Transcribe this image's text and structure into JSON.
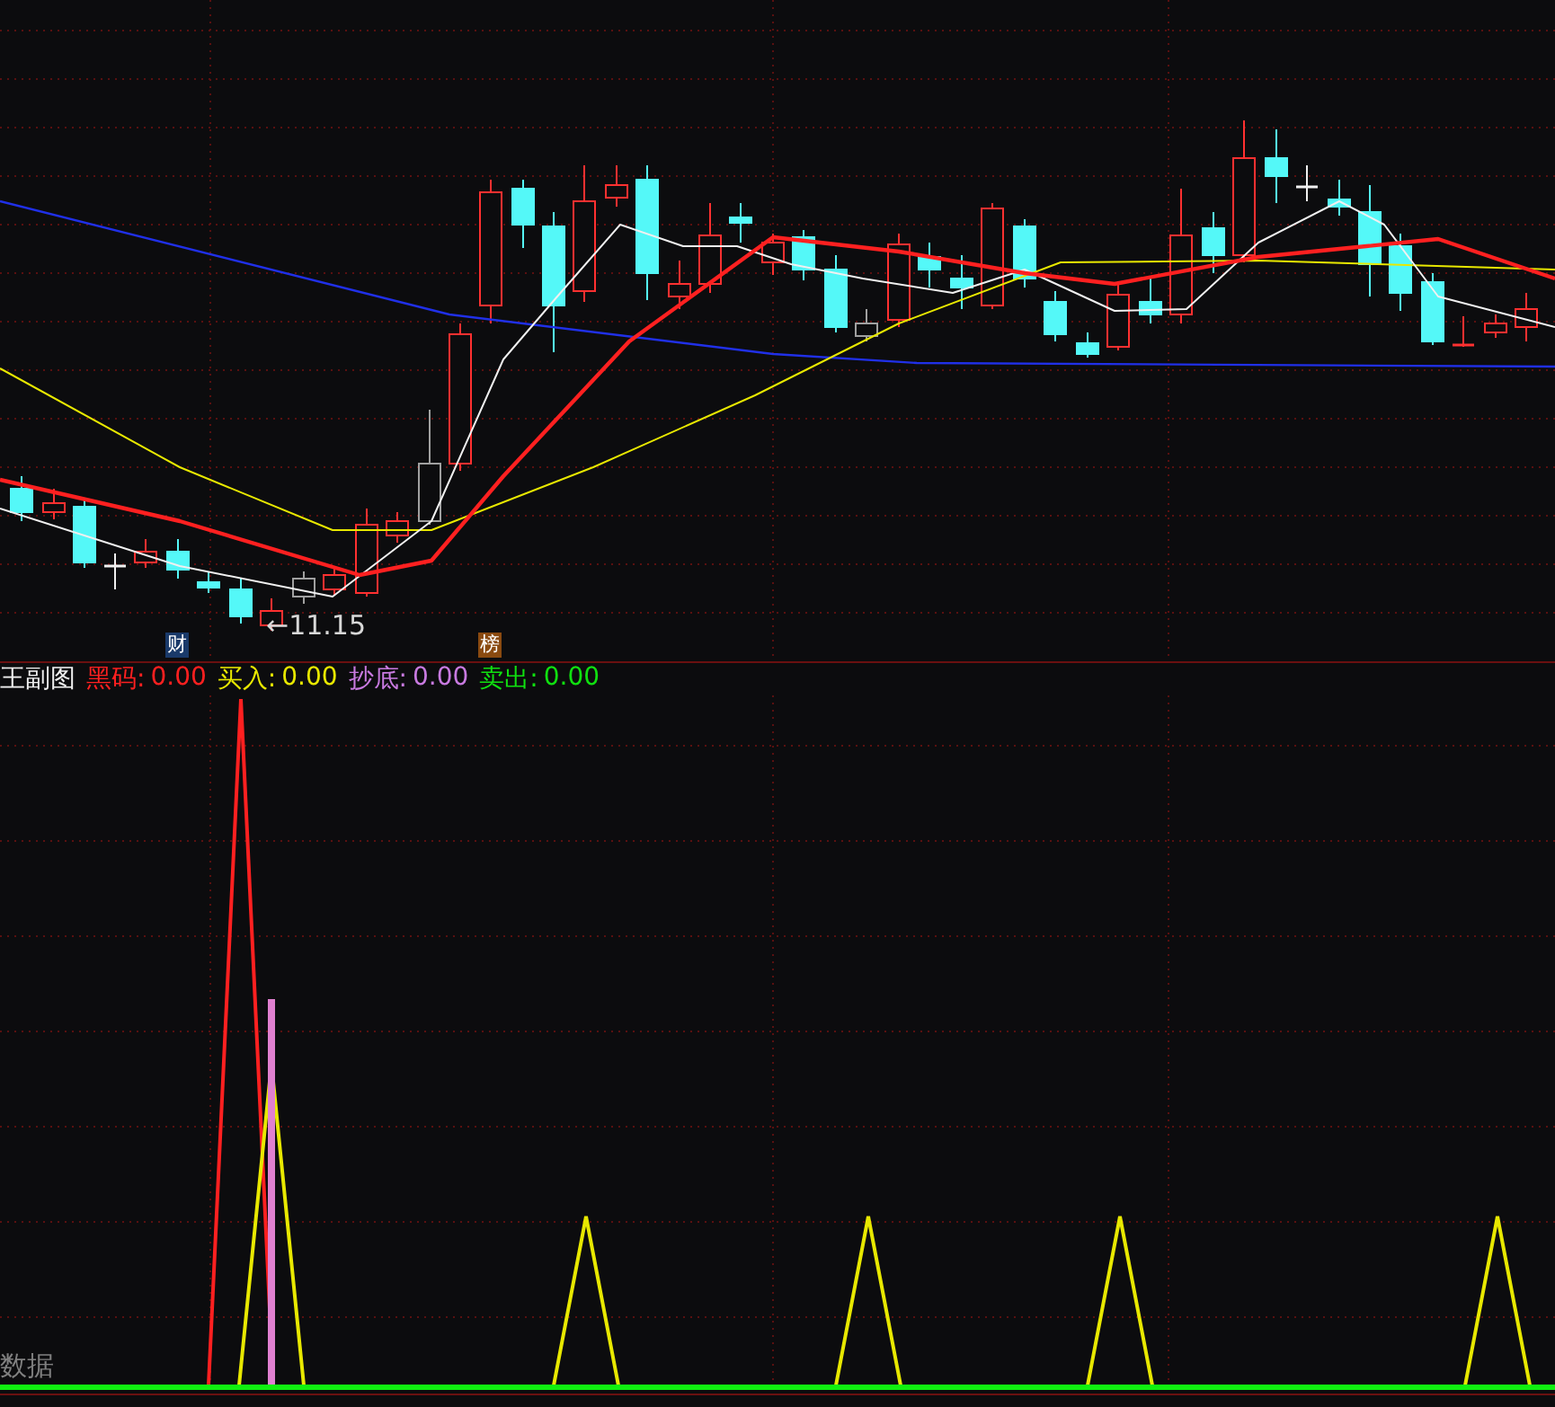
{
  "main_chart": {
    "markers": [
      {
        "text": "财",
        "kind": "finance",
        "color": "#1a3a6a"
      },
      {
        "text": "榜",
        "kind": "ranking",
        "color": "#8a4a10"
      }
    ],
    "price_label": "←11.15"
  },
  "indicator_legend": {
    "title": "王副图",
    "items": [
      {
        "label": "黑码:",
        "value": "0.00",
        "color": "#ff2020"
      },
      {
        "label": "买入:",
        "value": "0.00",
        "color": "#e8e800"
      },
      {
        "label": "抄底:",
        "value": "0.00",
        "color": "#c87ae0"
      },
      {
        "label": "卖出:",
        "value": "0.00",
        "color": "#10e010"
      }
    ]
  },
  "sub_chart": {
    "corner_label": "数据"
  }
}
